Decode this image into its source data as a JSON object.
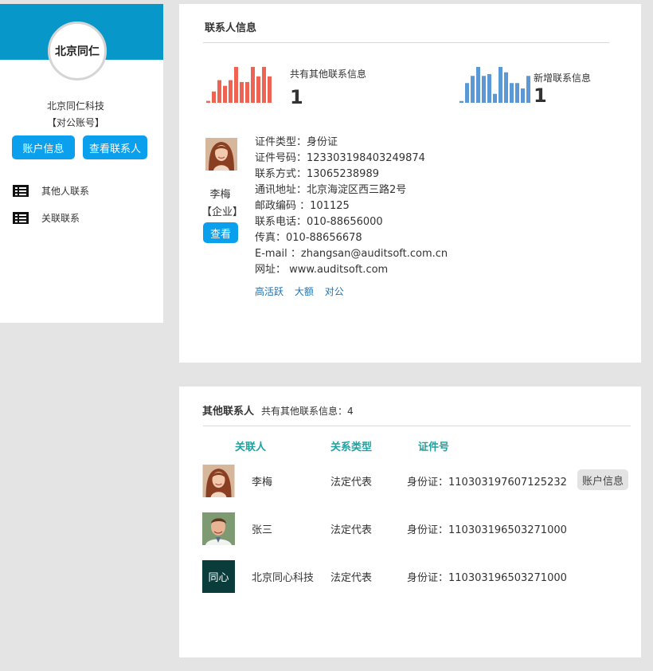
{
  "profile": {
    "avatar_text": "北京同仁",
    "company_name": "北京同仁科技",
    "account_type": "【对公账号】",
    "account_button": "账户信息",
    "view_contacts_button": "查看联系人",
    "brand_color": "#0797c9",
    "button_color": "#0aa0ee"
  },
  "sidebar": {
    "items": [
      {
        "label": "其他人联系",
        "icon": "list-icon"
      },
      {
        "label": "关联联系",
        "icon": "list-icon"
      }
    ]
  },
  "contact_info": {
    "title": "联系人信息",
    "stats": [
      {
        "label": "共有其他联系信息",
        "value": "1",
        "color": "#ee6352",
        "sparkline": [
          2,
          12,
          24,
          18,
          24,
          38,
          22,
          22,
          38,
          28,
          38,
          28
        ]
      },
      {
        "label": "新增联系信息",
        "value": "1",
        "color": "#5b99d6",
        "sparkline": [
          2,
          22,
          30,
          40,
          30,
          32,
          10,
          40,
          34,
          22,
          22,
          16,
          30
        ]
      }
    ],
    "person": {
      "name": "李梅",
      "type": "【企业】",
      "view_button": "查看",
      "details": [
        "证件类型：身份证",
        "证件号码：123303198403249874",
        "联系方式：13065238989",
        "通讯地址：北京海淀区西三路2号",
        "邮政编码 ：101125",
        "联系电话：010-88656000",
        "传真：010-88656678",
        "E-mail ：zhangsan@auditsoft.com.cn",
        "网址： www.auditsoft.com"
      ],
      "tags": [
        "高活跃",
        "大额",
        "对公"
      ]
    }
  },
  "other_contacts": {
    "title": "其他联系人",
    "count_text": "共有其他联系信息：4",
    "headers": [
      "关联人",
      "关系类型",
      "证件号"
    ],
    "rows": [
      {
        "name": "李梅",
        "relation": "法定代表",
        "id": "身份证：110303197607125232",
        "action": "账户信息"
      },
      {
        "name": "张三",
        "relation": "法定代表",
        "id": "身份证：110303196503271000"
      },
      {
        "name": "北京同心科技",
        "relation": "法定代表",
        "id": "身份证：110303196503271000",
        "logo_text": "同心"
      }
    ]
  }
}
